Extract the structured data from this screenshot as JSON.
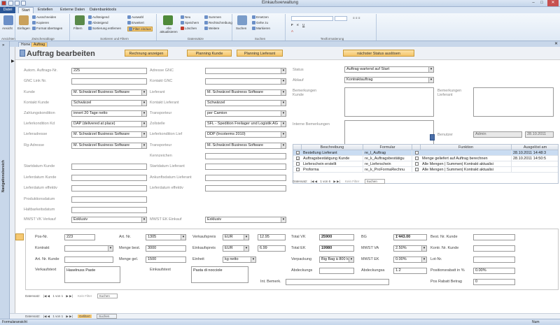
{
  "window": {
    "title": "Einkaufsverwaltung"
  },
  "ribbon": {
    "tabs": [
      "Datei",
      "Start",
      "Erstellen",
      "Externe Daten",
      "Datenbanktools"
    ],
    "groups": {
      "ansichten": {
        "label": "Ansichten",
        "ansicht": "Ansicht"
      },
      "zwischenablage": {
        "label": "Zwischenablage",
        "einfuegen": "Einfügen",
        "ausschneiden": "Ausschneiden",
        "kopieren": "Kopieren",
        "format": "Format übertragen"
      },
      "sortieren": {
        "label": "Sortieren und Filtern",
        "filtern": "Filtern",
        "aufsteigend": "Aufsteigend",
        "absteigend": "Absteigend",
        "sortierung": "Sortierung entfernen",
        "auswahl": "Auswahl",
        "erweitert": "Erweitert",
        "filter_ein": "Filter ein/aus"
      },
      "datensaetze": {
        "label": "Datensätze",
        "aktualisieren": "Alle aktualisieren",
        "neu": "Neu",
        "speichern": "Speichern",
        "loeschen": "Löschen",
        "summen": "Summen",
        "rechtschreibung": "Rechtschreibung",
        "weitere": "Weitere"
      },
      "suchen": {
        "label": "Suchen",
        "suchen": "Suchen",
        "ersetzen": "Ersetzen",
        "gehe_zu": "Gehe zu",
        "markieren": "Markieren"
      },
      "text": {
        "label": "Textformatierung"
      }
    }
  },
  "doctabs": {
    "home": "Home",
    "auftrag": "Auftrag"
  },
  "navpane": {
    "label": "Navigationsbereich"
  },
  "form": {
    "title": "Auftrag bearbeiten",
    "buttons": {
      "rechnung": "Rechnung anzeigen",
      "planung_kunde": "Planning Kunde",
      "planung_lieferant": "Planning Lieferant",
      "naechster": "nächster Status auslösen"
    },
    "left": [
      {
        "label": "Autom. Auftrags-Nr.",
        "value": "225",
        "dd": false
      },
      {
        "label": "GNC Link Nr.",
        "value": "",
        "dd": false
      },
      {
        "label": "Kunde",
        "value": "M. Schwärzel Business Software",
        "dd": true
      },
      {
        "label": "Kontakt Kunde",
        "value": "Schwärzel",
        "dd": true
      },
      {
        "label": "Zahlungskondition",
        "value": "innert 20 Tage netto",
        "dd": true
      },
      {
        "label": "Lieferkondition Kd",
        "value": "DAP (delivered at place)",
        "dd": true
      },
      {
        "label": "Lieferadresse",
        "value": "M. Schwärzel Business Software",
        "dd": true
      },
      {
        "label": "Rg-Adresse",
        "value": "M. Schwärzel Business Software",
        "dd": true
      }
    ],
    "left_dates": [
      {
        "label": "Startdatum Kunde",
        "value": ""
      },
      {
        "label": "Lieferdatum Kunde",
        "value": ""
      },
      {
        "label": "Lieferdatum effektiv",
        "value": ""
      },
      {
        "label": "Produktionsdatum",
        "value": ""
      },
      {
        "label": "Haltbarkeitsdatum",
        "value": ""
      }
    ],
    "mwst_vk": {
      "label": "MWST VK Verkauf",
      "value": "Exklusiv"
    },
    "middle": [
      {
        "label": "Adresse GNC",
        "value": "",
        "dd": true
      },
      {
        "label": "Kontakt GNC",
        "value": "",
        "dd": true
      },
      {
        "label": "Lieferant",
        "value": "M. Schwärzel Business Software",
        "dd": true
      },
      {
        "label": "Kontakt Lieferant",
        "value": "Schwärzel",
        "dd": true
      },
      {
        "label": "Transporteur",
        "value": "per Camion",
        "dd": true
      },
      {
        "label": "Zollstelle",
        "value": "SFL - Spedition Freilager und Logistik AG",
        "dd": true
      },
      {
        "label": "Lieferkondition Lief",
        "value": "DDP (Incoterms 2010)",
        "dd": true
      },
      {
        "label": "Transporteur",
        "value": "M. Schwärzel Business Software",
        "dd": true
      }
    ],
    "middle_dates": [
      {
        "label": "Kennzeichen",
        "value": ""
      },
      {
        "label": "Startdatum Lieferant",
        "value": ""
      },
      {
        "label": "Ankunftsdatum Lieferant",
        "value": ""
      },
      {
        "label": "Lieferdatum effektiv",
        "value": ""
      }
    ],
    "mwst_ek": {
      "label": "MWST EK Einkauf",
      "value": "Exklusiv"
    },
    "right": {
      "status_label": "Status",
      "status": "Auftrag wartend auf Start",
      "ablauf_label": "Ablauf",
      "ablauf": "Kontraktauftrag",
      "bem_kunde": "Bemerkungen Kunde",
      "bem_lieferant": "Bemerkungen Lieferant",
      "intern": "Interne Bemerkungen",
      "benutzer_label": "Benutzer",
      "benutzer": "Admin",
      "datum": "28.10.2011"
    },
    "subtable": {
      "headers": [
        "",
        "Beschreibung",
        "Formular",
        "",
        "Funktion",
        "Ausgelöst am"
      ],
      "rows": [
        {
          "desc": "Bestellung Lieferant",
          "form": "re_l_Auftrag",
          "func": "",
          "date": "28.10.2011 14:48:3",
          "checked": true,
          "selected": true
        },
        {
          "desc": "Auftragsbestätigung Kunde",
          "form": "re_k_Auftragsbestätigu",
          "func": "Menge geliefert auf Auftrag berechnen",
          "date": "28.10.2011 14:50:5",
          "checked": true,
          "selected": false
        },
        {
          "desc": "Lieferschein erstellt",
          "form": "re_Lieferschein",
          "func": "Alle Mengen | Summen| Kontrakt aktualisi",
          "date": "",
          "checked": false,
          "selected": false
        },
        {
          "desc": "Proforma",
          "form": "re_k_ProFormaRechnu",
          "func": "Alle Mengen | Summen| Kontrakt aktualisi",
          "date": "",
          "checked": false,
          "selected": false
        }
      ],
      "nav": {
        "label": "Datensatz:",
        "pos": "1 von 6",
        "filter": "Kein Filter",
        "search": "Suchen"
      }
    },
    "position": {
      "posnr_label": "Pos-Nr.",
      "posnr": "223",
      "kontrakt_label": "Kontrakt",
      "kontrakt": "",
      "artkunde_label": "Art. Nr. Kunde",
      "artkunde": "",
      "verkaufstext_label": "Verkaufstext",
      "verkaufstext": "Haselnuss Paste",
      "artnr_label": "Art. Nr.",
      "artnr": "1305",
      "mengebest_label": "Menge best.",
      "mengebest": "3000",
      "mengegel_label": "Menge gel.",
      "mengegel": "1500",
      "einkaufstext_label": "Einkaufstext",
      "einkaufstext": "Pasta di nocciole",
      "vkpreis_label": "Verkaufspreis",
      "vkwaehrung": "EUR",
      "vkpreis": "12.95",
      "ekpreis_label": "Einkaufspreis",
      "ekwaehrung": "EUR",
      "ekpreis": "6.99",
      "einheit_label": "Einheit",
      "einheit": "kg netto",
      "verpackung_label": "Verpackung",
      "verpackung": "Big Bag à 800 kg",
      "abdeckung_label": "Abdeckungs",
      "abdeckung": "",
      "intbem_label": "Int. Bemerk.",
      "intbem": "",
      "totalvk_label": "Total VK",
      "totalvk": "25900",
      "totalek_label": "Total EK",
      "totalek": "19980",
      "mwstvk_label": "MWST VK",
      "mwstvk": "0.00%",
      "abdeckungsa_label": "Abdeckungsa",
      "abdeckungsa": "1.2",
      "bg_label": "BG",
      "bg": "1'443.00",
      "mwstva_label": "MWST VA",
      "mwstva": "2.50%",
      "mwstek_label": "MWST EK",
      "mwstek": "0.00%",
      "positionsrabatt_label": "Positionsrabatt in %",
      "positionsrabatt": "0.00%",
      "bestkunde_label": "Best. Nr. Kunde",
      "bestkunde": "",
      "kontrkunde_label": "Kontr. Nr. Kunde",
      "kontrkunde": "",
      "lotnr_label": "Lot-Nr.",
      "lotnr": "",
      "posrabatt_label": "Pos Rabatt Betrag",
      "posrabatt": "0",
      "nav": {
        "label": "Datensatz:",
        "pos": "1 von 1",
        "filter": "Kein Filter",
        "search": "Suchen"
      }
    },
    "recnav": {
      "label": "Datensatz:",
      "pos": "1 von 1",
      "filter": "Gefiltert",
      "search": "Suchen"
    }
  },
  "statusbar": {
    "left": "Formularansicht",
    "right": "Num"
  }
}
